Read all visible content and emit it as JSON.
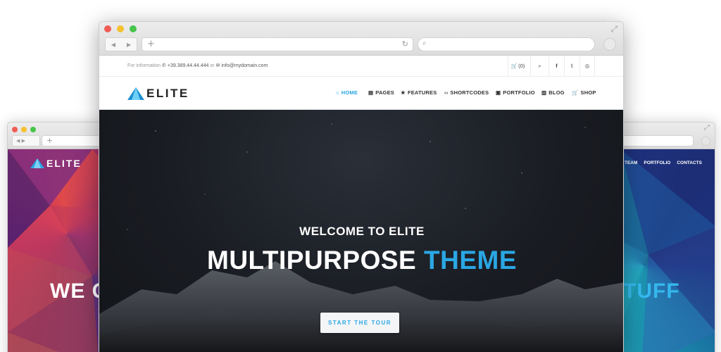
{
  "left_site": {
    "logo_text": "ELITE",
    "hero_partial": "WE C"
  },
  "right_site": {
    "nav": [
      "TEAM",
      "PORTFOLIO",
      "CONTACTS"
    ],
    "hero_partial": "TUFF"
  },
  "main_site": {
    "topbar": {
      "info_label": "For information",
      "phone_icon": "phone-icon",
      "phone": "+39.389.44.44.444",
      "or_text": "or",
      "mail_icon": "envelope-icon",
      "email": "info@mydomain.com",
      "cart_label": "(0)"
    },
    "logo_text": "ELITE",
    "nav": [
      {
        "label": "HOME",
        "icon": "home-icon",
        "glyph": "⌂",
        "active": true
      },
      {
        "label": "PAGES",
        "icon": "document-icon",
        "glyph": "▤",
        "active": false
      },
      {
        "label": "FEATURES",
        "icon": "star-icon",
        "glyph": "★",
        "active": false
      },
      {
        "label": "SHORTCODES",
        "icon": "code-icon",
        "glyph": "‹›",
        "active": false
      },
      {
        "label": "PORTFOLIO",
        "icon": "briefcase-icon",
        "glyph": "▣",
        "active": false
      },
      {
        "label": "BLOG",
        "icon": "book-icon",
        "glyph": "▥",
        "active": false
      },
      {
        "label": "SHOP",
        "icon": "cart-icon",
        "glyph": "🛒",
        "active": false
      }
    ],
    "hero": {
      "welcome": "WELCOME TO ELITE",
      "title_white": "MULTIPURPOSE",
      "title_blue": "THEME",
      "cta": "START THE TOUR"
    }
  },
  "colors": {
    "accent": "#2aa7e4",
    "hero_dark": "#191c22"
  }
}
